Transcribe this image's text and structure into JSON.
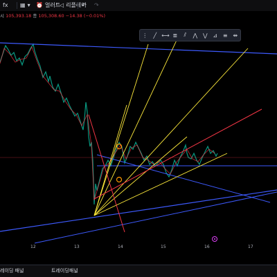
{
  "toolbar": {
    "item1_label": "fx",
    "item2_label": "얼러트",
    "item3_label": "리플레이",
    "undo_icon": "undo-icon",
    "redo_icon": "redo-icon"
  },
  "infobar": {
    "value1": "105,393.18",
    "close_label": "종",
    "close_value": "105,308.60",
    "change": "−14.38 (−0.01%)"
  },
  "x_axis": {
    "ticks": [
      "12",
      "13",
      "14",
      "15",
      "16",
      "17"
    ]
  },
  "bottombar": {
    "tab1": "레이딩 패널",
    "tab2": "트레이딩패널"
  },
  "drawing_toolbar": {
    "tools": [
      "grip-icon",
      "trendline-icon",
      "horizontal-line-icon",
      "fib-icon",
      "channel-icon",
      "pattern-icon",
      "pattern2-icon",
      "projection-icon",
      "text-icon",
      "measure-icon"
    ]
  },
  "colors": {
    "background": "#000000",
    "blue_lines": "#3d5afe",
    "yellow_lines": "#ffeb3b",
    "red_lines": "#f23645",
    "marker": "#e040fb"
  }
}
